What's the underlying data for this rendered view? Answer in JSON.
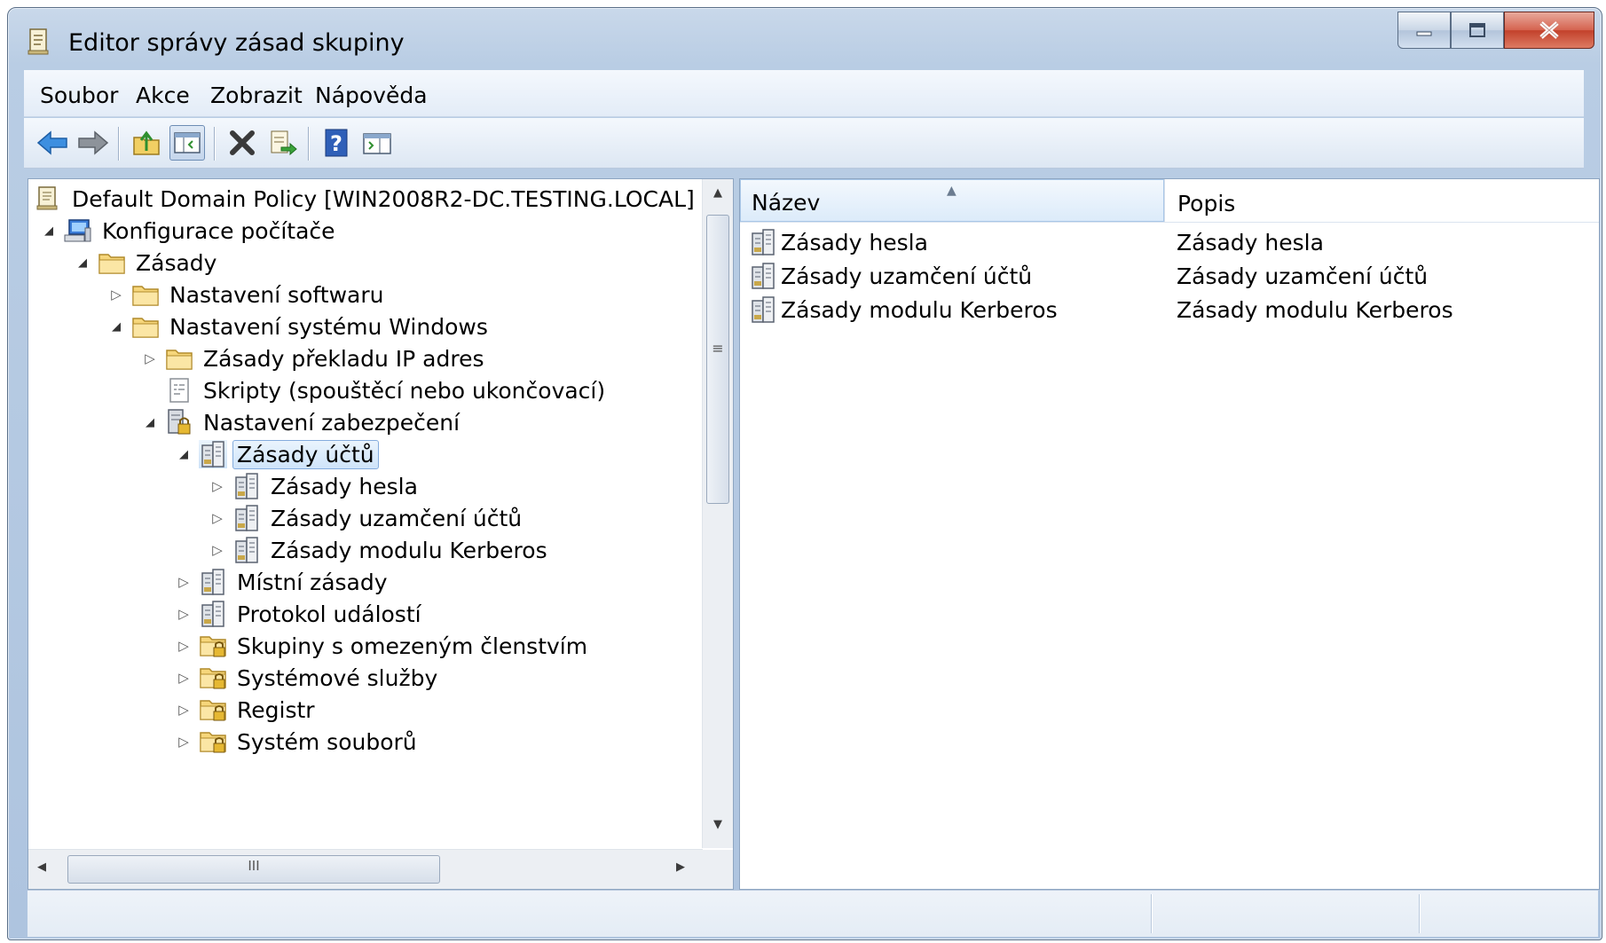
{
  "window": {
    "title": "Editor správy zásad skupiny"
  },
  "menu": [
    "Soubor",
    "Akce",
    "Zobrazit",
    "Nápověda"
  ],
  "toolbar": {
    "buttons": [
      "back-icon",
      "forward-icon",
      "up-folder-icon",
      "show-hide-tree-icon",
      "delete-icon",
      "export-list-icon",
      "help-icon",
      "show-hide-action-pane-icon"
    ],
    "pressed": "show-hide-tree-icon"
  },
  "tree": {
    "root": "Default Domain Policy [WIN2008R2-DC.TESTING.LOCAL]",
    "items": [
      {
        "label": "Konfigurace počítače",
        "expander": "expanded",
        "icon": "computer-icon"
      },
      {
        "label": "Zásady",
        "expander": "expanded",
        "icon": "folder-icon"
      },
      {
        "label": "Nastavení softwaru",
        "expander": "collapsed",
        "icon": "folder-icon"
      },
      {
        "label": "Nastavení systému Windows",
        "expander": "expanded",
        "icon": "folder-icon"
      },
      {
        "label": "Zásady překladu IP adres",
        "expander": "collapsed",
        "icon": "folder-icon"
      },
      {
        "label": "Skripty (spouštěcí nebo ukončovací)",
        "expander": "none",
        "icon": "script-icon"
      },
      {
        "label": "Nastavení zabezpečení",
        "expander": "expanded",
        "icon": "security-settings-icon"
      },
      {
        "label": "Zásady účtů",
        "expander": "expanded",
        "icon": "policy-icon",
        "selected": true
      },
      {
        "label": "Zásady hesla",
        "expander": "collapsed",
        "icon": "policy-icon"
      },
      {
        "label": "Zásady uzamčení účtů",
        "expander": "collapsed",
        "icon": "policy-icon"
      },
      {
        "label": "Zásady modulu Kerberos",
        "expander": "collapsed",
        "icon": "policy-icon"
      },
      {
        "label": "Místní zásady",
        "expander": "collapsed",
        "icon": "policy-icon"
      },
      {
        "label": "Protokol událostí",
        "expander": "collapsed",
        "icon": "policy-icon"
      },
      {
        "label": "Skupiny s omezeným členstvím",
        "expander": "collapsed",
        "icon": "locked-folder-icon"
      },
      {
        "label": "Systémové služby",
        "expander": "collapsed",
        "icon": "locked-folder-icon"
      },
      {
        "label": "Registr",
        "expander": "collapsed",
        "icon": "locked-folder-icon"
      },
      {
        "label": "Systém souborů",
        "expander": "collapsed",
        "icon": "locked-folder-icon"
      }
    ]
  },
  "list": {
    "columns": {
      "name": "Název",
      "description": "Popis"
    },
    "rows": [
      {
        "name": "Zásady hesla",
        "description": "Zásady hesla"
      },
      {
        "name": "Zásady uzamčení účtů",
        "description": "Zásady uzamčení účtů"
      },
      {
        "name": "Zásady modulu Kerberos",
        "description": "Zásady modulu Kerberos"
      }
    ]
  },
  "scrollbar_glyphs": {
    "up": "▲",
    "down": "▼",
    "left": "◀",
    "right": "▶",
    "grip_v": "≡",
    "grip_h": "III"
  }
}
